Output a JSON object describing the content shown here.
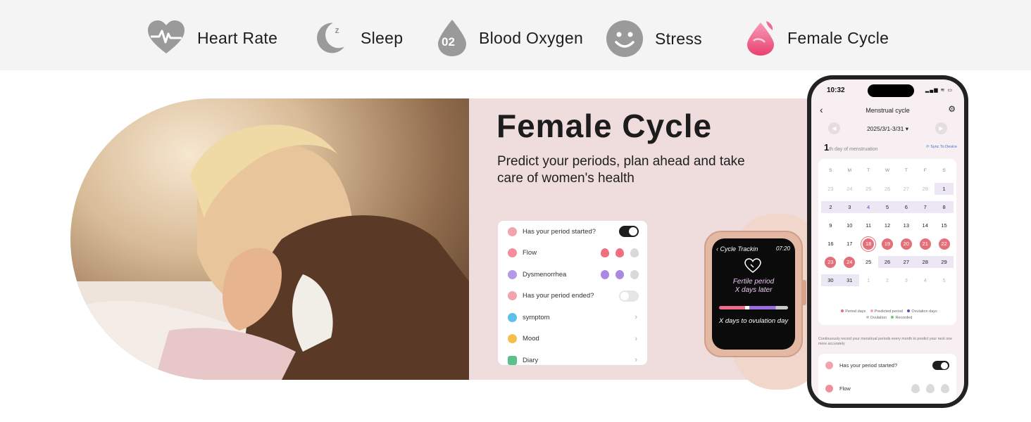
{
  "features": [
    {
      "label": "Heart Rate",
      "icon": "heart-rate-icon"
    },
    {
      "label": "Sleep",
      "icon": "moon-sleep-icon"
    },
    {
      "label": "Blood Oxygen",
      "icon": "blood-oxygen-drop-icon",
      "badge": "02"
    },
    {
      "label": "Stress",
      "icon": "smiley-stress-icon"
    },
    {
      "label": "Female Cycle",
      "icon": "female-cycle-drop-icon"
    }
  ],
  "banner": {
    "title": "Female Cycle",
    "subtitle": "Predict your periods, plan ahead and take care of women's health"
  },
  "card": {
    "rows": [
      {
        "label": "Has your period started?",
        "control": "toggle-on"
      },
      {
        "label": "Flow",
        "control": "drops"
      },
      {
        "label": "Dysmenorrhea",
        "control": "faces"
      },
      {
        "label": "Has your period ended?",
        "control": "toggle-off"
      },
      {
        "label": "symptom",
        "control": "chevron"
      },
      {
        "label": "Mood",
        "control": "chevron"
      },
      {
        "label": "Diary",
        "control": "chevron"
      }
    ]
  },
  "watch": {
    "header": "Cycle Trackin",
    "time": "07:20",
    "fertile": "Fertile period",
    "days_later": "X days later",
    "ovulation": "X days to ovulation day"
  },
  "phone": {
    "time": "10:32",
    "title": "Menstrual cycle",
    "range": "2025/3/1-3/31 ▾",
    "day_number": "1",
    "day_suffix": "th day of menstruation",
    "sync": "Sync To Device",
    "weekdays": [
      "S",
      "M",
      "T",
      "W",
      "T",
      "F",
      "S"
    ],
    "calendar": [
      [
        "23",
        "24",
        "25",
        "26",
        "27",
        "28",
        "1"
      ],
      [
        "2",
        "3",
        "4",
        "5",
        "6",
        "7",
        "8"
      ],
      [
        "9",
        "10",
        "11",
        "12",
        "13",
        "14",
        "15"
      ],
      [
        "16",
        "17",
        "18",
        "19",
        "20",
        "21",
        "22"
      ],
      [
        "23",
        "24",
        "25",
        "26",
        "27",
        "28",
        "29"
      ],
      [
        "30",
        "31",
        "1",
        "2",
        "3",
        "4",
        "5"
      ]
    ],
    "legend_1": [
      "Period days",
      "Predicted period",
      "Ovulation days"
    ],
    "legend_2": [
      "Ovulation",
      "Recorded"
    ],
    "note": "Continuously record your menstrual periods every month to predict your next one more accurately",
    "rows": [
      {
        "label": "Has your period started?"
      },
      {
        "label": "Flow"
      }
    ]
  },
  "colors": {
    "accent_pink": "#e46f78",
    "ovulation_purple": "#6648b8",
    "panel_pink": "#efdcdc"
  }
}
